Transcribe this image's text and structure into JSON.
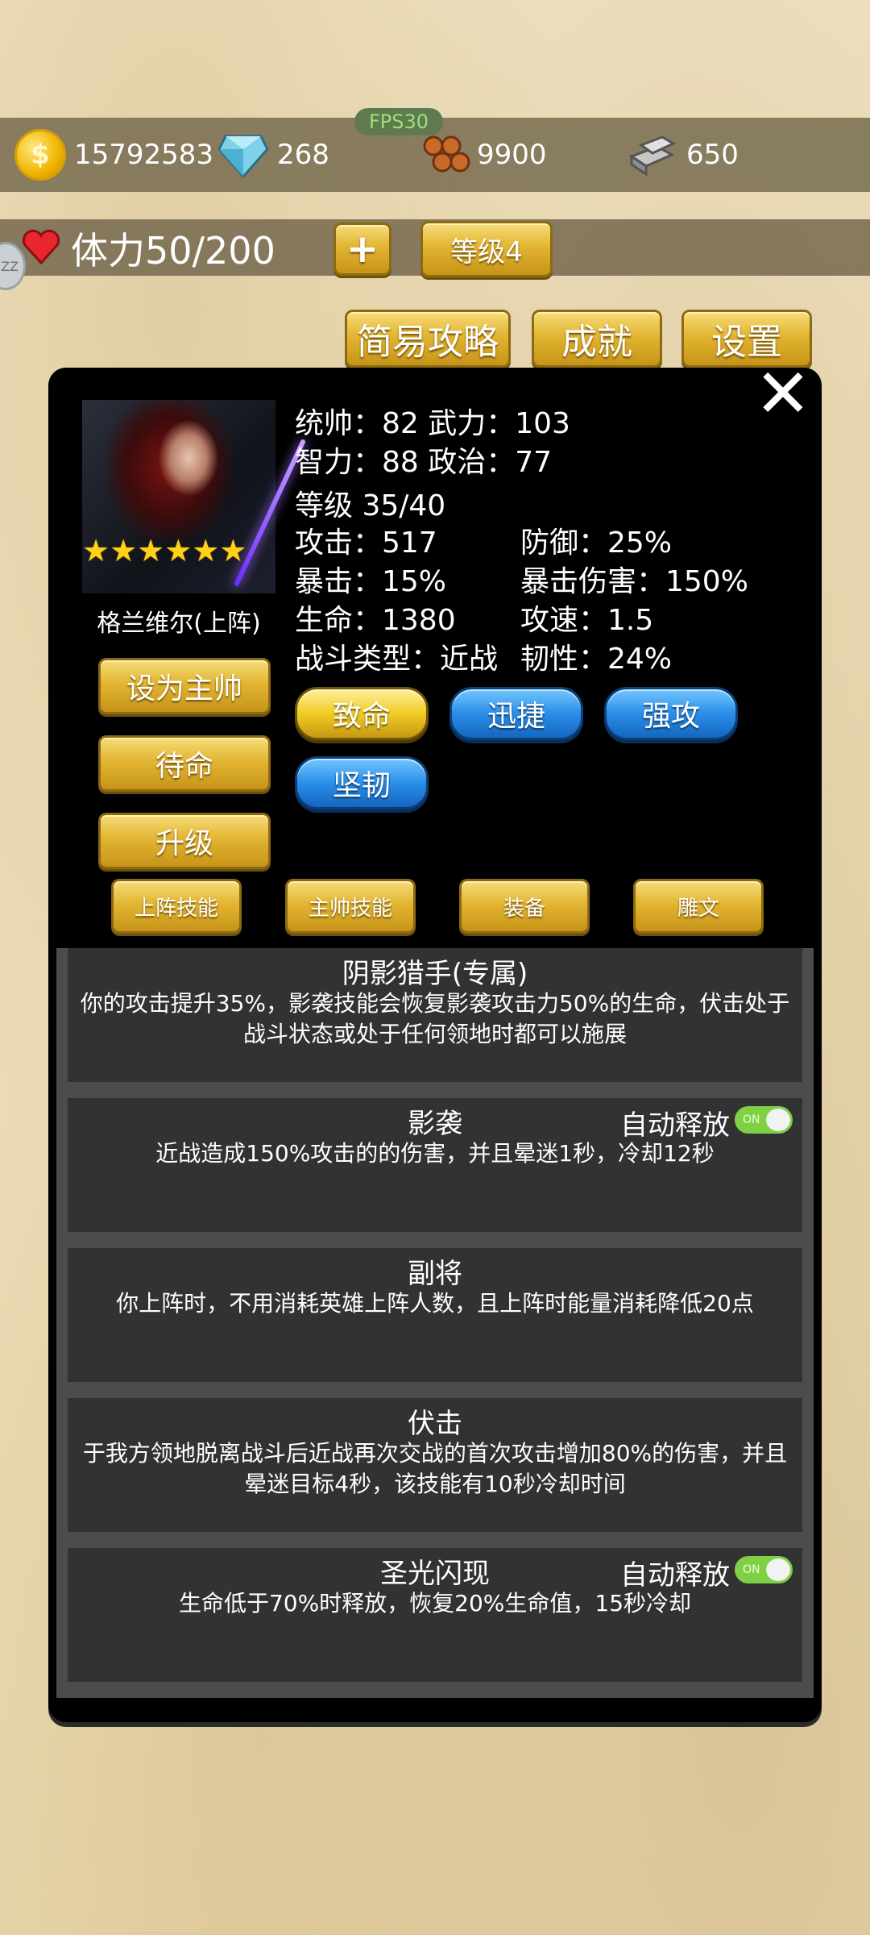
{
  "resources": {
    "gold": "15792583",
    "diamond": "268",
    "wood": "9900",
    "iron": "650",
    "fps": "FPS30"
  },
  "status": {
    "stamina": "体力50/200",
    "plus_label": "+",
    "level": "等级4",
    "side_badge": "ZZ"
  },
  "top_buttons": {
    "guide": "简易攻略",
    "achievement": "成就",
    "settings": "设置"
  },
  "hero": {
    "name": "格兰维尔(上阵)",
    "stars": 6,
    "stars_text": "★★★★★★",
    "stats": {
      "line1": "统帅：82 武力：103",
      "line2": "智力：88 政治：77",
      "level": "等级 35/40",
      "attack": "攻击：517",
      "defense": "防御：25%",
      "crit": "暴击：15%",
      "crit_damage": "暴击伤害：150%",
      "hp": "生命：1380",
      "attack_speed": "攻速：1.5",
      "combat_type": "战斗类型：近战",
      "toughness": "韧性：24%"
    },
    "traits": [
      "致命",
      "迅捷",
      "强攻",
      "坚韧"
    ]
  },
  "actions": {
    "set_commander": "设为主帅",
    "standby": "待命",
    "upgrade": "升级"
  },
  "tabs": [
    "上阵技能",
    "主帅技能",
    "装备",
    "雕文"
  ],
  "skills": [
    {
      "title": "阴影猎手(专属)",
      "desc": "你的攻击提升35%，影袭技能会恢复影袭攻击力50%的生命，伏击处于战斗状态或处于任何领地时都可以施展",
      "auto": ""
    },
    {
      "title": "影袭",
      "desc": "近战造成150%攻击的的伤害，并且晕迷1秒，冷却12秒",
      "auto": "自动释放"
    },
    {
      "title": "副将",
      "desc": "你上阵时，不用消耗英雄上阵人数，且上阵时能量消耗降低20点",
      "auto": ""
    },
    {
      "title": "伏击",
      "desc": "于我方领地脱离战斗后近战再次交战的首次攻击增加80%的伤害，并且晕迷目标4秒，该技能有10秒冷却时间",
      "auto": ""
    },
    {
      "title": "圣光闪现",
      "desc": "生命低于70%时释放，恢复20%生命值，15秒冷却",
      "auto": "自动释放"
    }
  ],
  "toggle_label": "ON"
}
